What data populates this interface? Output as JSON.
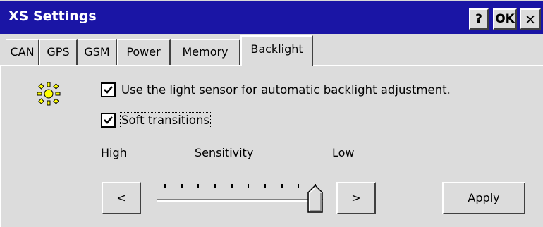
{
  "window": {
    "title": "XS Settings",
    "help_label": "?",
    "ok_label": "OK",
    "close_label": "×"
  },
  "tabs": [
    {
      "label": "CAN",
      "active": false
    },
    {
      "label": "GPS",
      "active": false
    },
    {
      "label": "GSM",
      "active": false
    },
    {
      "label": "Power",
      "active": false
    },
    {
      "label": "Memory",
      "active": false
    },
    {
      "label": "Backlight",
      "active": true
    }
  ],
  "backlight": {
    "icon": "sun-icon",
    "light_sensor": {
      "label": "Use the light sensor for automatic backlight adjustment.",
      "checked": true
    },
    "soft_transitions": {
      "label": "Soft transitions",
      "checked": true
    },
    "sensitivity": {
      "high_label": "High",
      "title": "Sensitivity",
      "low_label": "Low",
      "tick_count": 10,
      "value_fraction": 1.0
    },
    "decrease_label": "<",
    "increase_label": ">",
    "apply_label": "Apply"
  },
  "colors": {
    "titlebar": "#1a15a5",
    "face": "#dcdcdc",
    "sun": "#ffff00"
  }
}
